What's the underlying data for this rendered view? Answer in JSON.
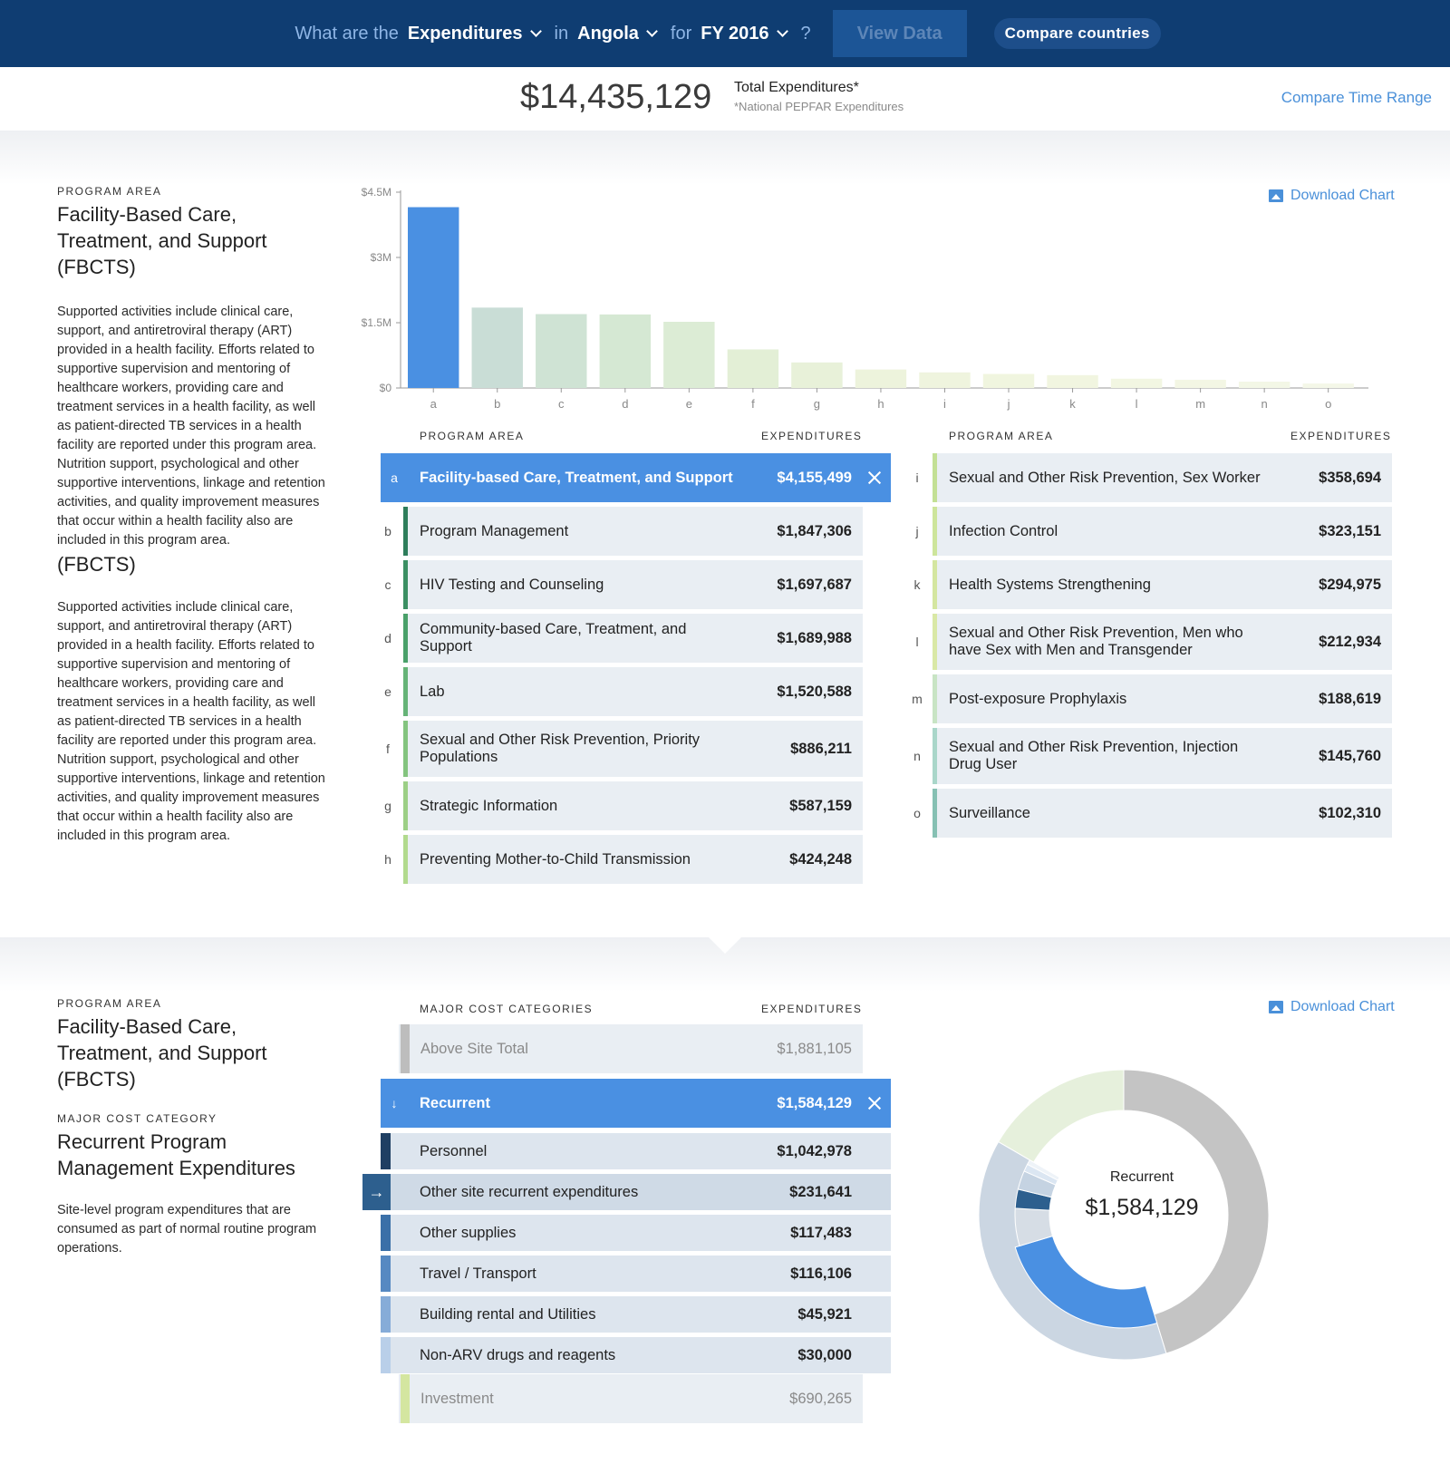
{
  "nav": {
    "prefix": "What are the",
    "metric": "Expenditures",
    "in": "in",
    "country": "Angola",
    "for": "for",
    "year": "FY 2016",
    "qmark": "?",
    "view_button": "View Data",
    "compare_button": "Compare countries"
  },
  "summary": {
    "total": "$14,435,129",
    "label": "Total Expenditures*",
    "note": "*National PEPFAR Expenditures",
    "compare_time": "Compare Time Range"
  },
  "section1": {
    "kicker": "PROGRAM AREA",
    "title": "Facility-Based Care, Treatment, and Support (FBCTS)",
    "description": "Supported activities include clinical care, support, and antiretroviral therapy (ART) provided in a health facility. Efforts related to supportive supervision and mentoring of healthcare workers, providing care and treatment services in a health facility, as well as patient-directed TB services in a health facility are reported under this program area. Nutrition support, psychological and other supportive interventions, linkage and retention activities, and quality improvement measures that occur within a health facility also are included in this program area.",
    "overflow_fragment": "(FBCTS)",
    "download": "Download Chart",
    "table_headers": {
      "program": "PROGRAM AREA",
      "expenditures": "EXPENDITURES"
    }
  },
  "program_rows": [
    {
      "letter": "a",
      "name": "Facility-based Care, Treatment, and Support",
      "amount": "$4,155,499",
      "color": "#4a90e2"
    },
    {
      "letter": "b",
      "name": "Program Management",
      "amount": "$1,847,306",
      "color": "#2e7d5b"
    },
    {
      "letter": "c",
      "name": "HIV Testing and Counseling",
      "amount": "$1,697,687",
      "color": "#3b8f63"
    },
    {
      "letter": "d",
      "name": "Community-based Care, Treatment, and Support",
      "amount": "$1,689,988",
      "color": "#4aa06a"
    },
    {
      "letter": "e",
      "name": "Lab",
      "amount": "$1,520,588",
      "color": "#66b377"
    },
    {
      "letter": "f",
      "name": "Sexual and Other Risk Prevention, Priority Populations",
      "amount": "$886,211",
      "color": "#84c47f"
    },
    {
      "letter": "g",
      "name": "Strategic Information",
      "amount": "$587,159",
      "color": "#9ccf86"
    },
    {
      "letter": "h",
      "name": "Preventing Mother-to-Child Transmission",
      "amount": "$424,248",
      "color": "#b2da8e"
    },
    {
      "letter": "i",
      "name": "Sexual and Other Risk Prevention, Sex Worker",
      "amount": "$358,694",
      "color": "#c3e095"
    },
    {
      "letter": "j",
      "name": "Infection Control",
      "amount": "$323,151",
      "color": "#cde59b"
    },
    {
      "letter": "k",
      "name": "Health Systems Strengthening",
      "amount": "$294,975",
      "color": "#d4e6a0"
    },
    {
      "letter": "l",
      "name": "Sexual and Other Risk Prevention, Men who have Sex with Men and Transgender",
      "amount": "$212,934",
      "color": "#d9e8a6"
    },
    {
      "letter": "m",
      "name": "Post-exposure Prophylaxis",
      "amount": "$188,619",
      "color": "#c8e4c4"
    },
    {
      "letter": "n",
      "name": "Sexual and Other Risk Prevention, Injection Drug User",
      "amount": "$145,760",
      "color": "#a9d6c9"
    },
    {
      "letter": "o",
      "name": "Surveillance",
      "amount": "$102,310",
      "color": "#86c0b3"
    }
  ],
  "chart_data": [
    {
      "type": "bar",
      "categories": [
        "a",
        "b",
        "c",
        "d",
        "e",
        "f",
        "g",
        "h",
        "i",
        "j",
        "k",
        "l",
        "m",
        "n",
        "o"
      ],
      "values": [
        4155499,
        1847306,
        1697687,
        1689988,
        1520588,
        886211,
        587159,
        424248,
        358694,
        323151,
        294975,
        212934,
        188619,
        145760,
        102310
      ],
      "colors": [
        "#4a90e2",
        "#c9ddd6",
        "#cfe3d4",
        "#d5e8d3",
        "#dcecd5",
        "#e3efd6",
        "#e8f1d9",
        "#edf3dc",
        "#eff4de",
        "#f0f5df",
        "#f1f5e0",
        "#f2f6e2",
        "#f3f6e4",
        "#f3f7e6",
        "#f4f7e8"
      ],
      "yticks": [
        "$0",
        "$1.5M",
        "$3M",
        "$4.5M"
      ],
      "ytick_values": [
        0,
        1500000,
        3000000,
        4500000
      ],
      "ylim": [
        0,
        4500000
      ]
    },
    {
      "type": "pie",
      "center_label": "Recurrent",
      "center_value": "$1,584,129",
      "outer": [
        {
          "label": "Above Site Total",
          "value": 1881105,
          "color": "#c4c4c4"
        },
        {
          "label": "Recurrent",
          "value": 1584129,
          "color": "#cbd6e2"
        },
        {
          "label": "Investment",
          "value": 690265,
          "color": "#e6f0dc"
        }
      ],
      "inner": [
        {
          "label": "Personnel",
          "value": 1042978,
          "color": "#4a90e2"
        },
        {
          "label": "Other site recurrent expenditures",
          "value": 231641,
          "color": "#d6dde5"
        },
        {
          "label": "Other supplies",
          "value": 117483,
          "color": "#2d5f8e"
        },
        {
          "label": "Travel / Transport",
          "value": 116106,
          "color": "#c5d3e2"
        },
        {
          "label": "Building rental and Utilities",
          "value": 45921,
          "color": "#dbe6f2"
        },
        {
          "label": "Non-ARV drugs and reagents",
          "value": 30000,
          "color": "#eef3f8"
        }
      ]
    }
  ],
  "section2": {
    "kicker": "PROGRAM AREA",
    "title": "Facility-Based Care, Treatment, and Support (FBCTS)",
    "kicker2": "MAJOR COST CATEGORY",
    "title2": "Recurrent Program Management Expenditures",
    "description": "Site-level program expenditures that are consumed as part of normal routine program operations.",
    "download": "Download Chart",
    "table_headers": {
      "category": "MAJOR COST CATEGORIES",
      "expenditures": "EXPENDITURES"
    },
    "above_site": {
      "name": "Above Site Total",
      "amount": "$1,881,105"
    },
    "recurrent": {
      "name": "Recurrent",
      "amount": "$1,584,129"
    },
    "sub_rows": [
      {
        "name": "Personnel",
        "amount": "$1,042,978",
        "color": "#1f3f63"
      },
      {
        "name": "Other site recurrent expenditures",
        "amount": "$231,641",
        "color": "#2d5f8e"
      },
      {
        "name": "Other supplies",
        "amount": "$117,483",
        "color": "#3b70a8"
      },
      {
        "name": "Travel / Transport",
        "amount": "$116,106",
        "color": "#5689c2"
      },
      {
        "name": "Building rental and Utilities",
        "amount": "$45,921",
        "color": "#86acd8"
      },
      {
        "name": "Non-ARV drugs and reagents",
        "amount": "$30,000",
        "color": "#b9cfe9"
      }
    ],
    "investment": {
      "name": "Investment",
      "amount": "$690,265"
    }
  }
}
